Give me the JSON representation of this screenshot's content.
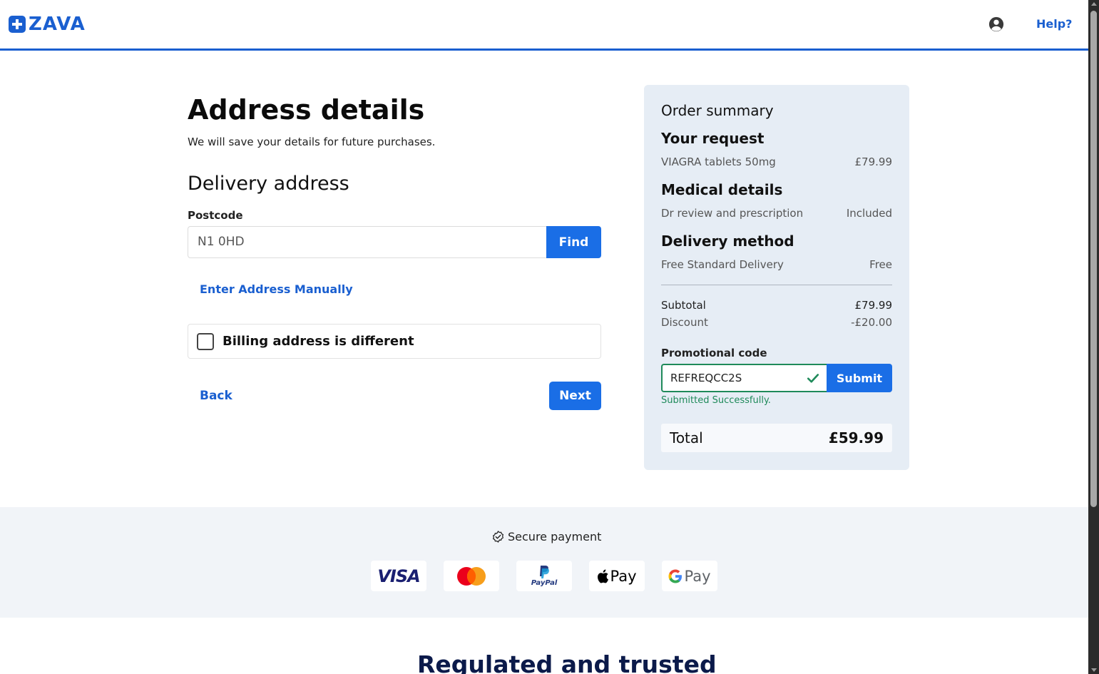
{
  "header": {
    "logo_text": "ZAVA",
    "help_label": "Help?"
  },
  "form": {
    "title": "Address details",
    "subtitle": "We will save your details for future purchases.",
    "section_title": "Delivery address",
    "postcode_label": "Postcode",
    "postcode_value": "N1 0HD",
    "find_label": "Find",
    "manual_link": "Enter Address Manually",
    "billing_label": "Billing address is different",
    "billing_checked": false,
    "back_label": "Back",
    "next_label": "Next"
  },
  "summary": {
    "title": "Order summary",
    "sections": [
      {
        "heading": "Your request",
        "item": "VIAGRA tablets 50mg",
        "value": "£79.99"
      },
      {
        "heading": "Medical details",
        "item": "Dr review and prescription",
        "value": "Included"
      },
      {
        "heading": "Delivery method",
        "item": "Free Standard Delivery",
        "value": "Free"
      }
    ],
    "subtotal_label": "Subtotal",
    "subtotal_value": "£79.99",
    "discount_label": "Discount",
    "discount_value": "-£20.00",
    "promo_label": "Promotional code",
    "promo_value": "REFREQCC2S",
    "submit_label": "Submit",
    "promo_message": "Submitted Successfully.",
    "total_label": "Total",
    "total_value": "£59.99"
  },
  "payment": {
    "secure_label": "Secure payment",
    "methods": [
      {
        "name": "visa",
        "label": "VISA"
      },
      {
        "name": "mastercard",
        "label": ""
      },
      {
        "name": "paypal",
        "label": "PayPal"
      },
      {
        "name": "apple-pay",
        "label": "Pay"
      },
      {
        "name": "google-pay",
        "label": "Pay"
      }
    ]
  },
  "footer": {
    "regulated_title": "Regulated and trusted"
  },
  "colors": {
    "brand": "#1a5fd0",
    "button": "#1a6ee6",
    "success": "#1f8a5a",
    "summary_bg": "#e6edf5"
  }
}
